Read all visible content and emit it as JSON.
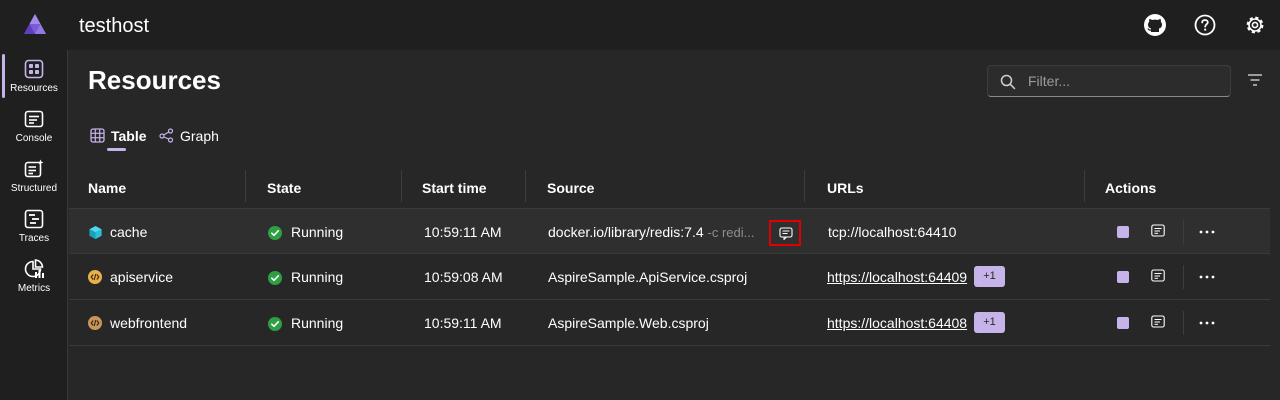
{
  "header": {
    "title": "testhost",
    "icons": [
      "aspire-logo-icon",
      "github-icon",
      "help-icon",
      "settings-icon"
    ]
  },
  "nav": {
    "items": [
      {
        "label": "Resources",
        "icon": "resources-icon",
        "active": true
      },
      {
        "label": "Console",
        "icon": "console-icon"
      },
      {
        "label": "Structured",
        "icon": "structured-icon"
      },
      {
        "label": "Traces",
        "icon": "traces-icon"
      },
      {
        "label": "Metrics",
        "icon": "metrics-icon"
      }
    ]
  },
  "page": {
    "title": "Resources",
    "filter": {
      "placeholder": "Filter...",
      "value": ""
    },
    "tabs": [
      {
        "label": "Table",
        "icon": "table-icon",
        "active": true
      },
      {
        "label": "Graph",
        "icon": "graph-icon"
      }
    ]
  },
  "table": {
    "columns": [
      "Name",
      "State",
      "Start time",
      "Source",
      "URLs",
      "Actions"
    ],
    "rows": [
      {
        "name": "cache",
        "icon": "container-icon",
        "state": "Running",
        "start_time": "10:59:11 AM",
        "source": "docker.io/library/redis:7.4",
        "source_args": "-c redi...",
        "url": "tcp://localhost:64410",
        "url_is_link": false,
        "extra_urls": ""
      },
      {
        "name": "apiservice",
        "icon": "project-icon",
        "state": "Running",
        "start_time": "10:59:08 AM",
        "source": "AspireSample.ApiService.csproj",
        "source_args": "",
        "url": "https://localhost:64409",
        "url_is_link": true,
        "extra_urls": "+1"
      },
      {
        "name": "webfrontend",
        "icon": "project-icon",
        "state": "Running",
        "start_time": "10:59:11 AM",
        "source": "AspireSample.Web.csproj",
        "source_args": "",
        "url": "https://localhost:64408",
        "url_is_link": true,
        "extra_urls": "+1"
      }
    ]
  },
  "colors": {
    "accent": "#c5b3ea",
    "running": "#2ea043",
    "background": "#272727",
    "chrome": "#1f1f1f",
    "highlight": "#e00000"
  }
}
